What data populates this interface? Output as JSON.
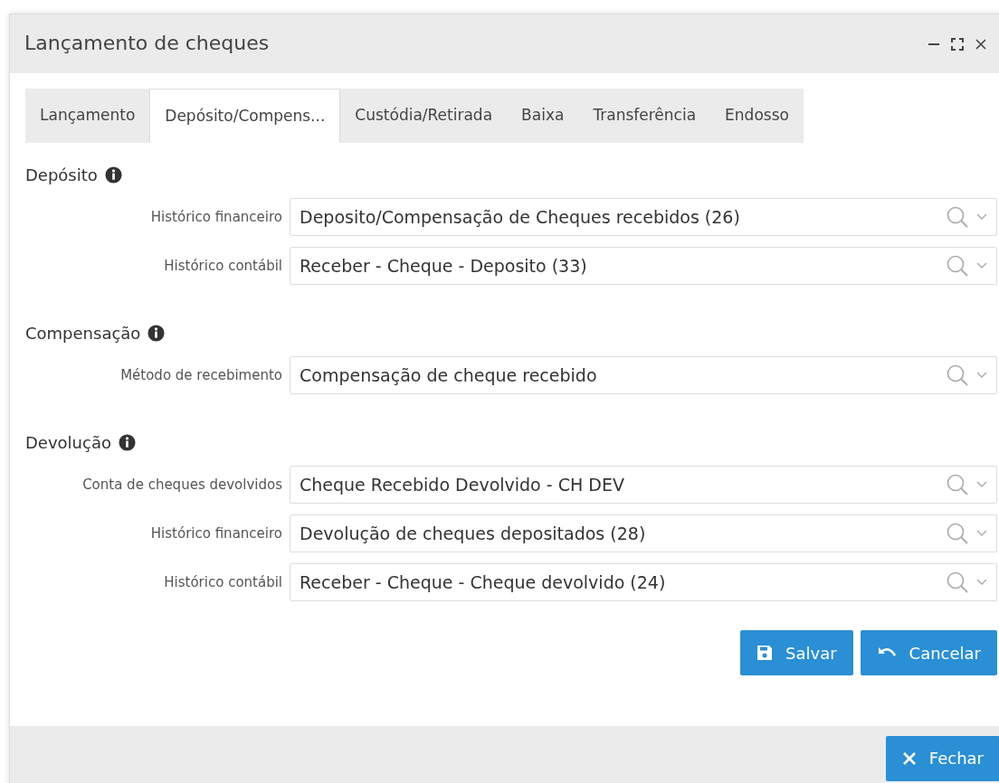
{
  "window": {
    "title": "Lançamento de cheques"
  },
  "tabs": [
    {
      "label": "Lançamento",
      "selected": false
    },
    {
      "label": "Depósito/Compens...",
      "selected": true
    },
    {
      "label": "Custódia/Retirada",
      "selected": false
    },
    {
      "label": "Baixa",
      "selected": false
    },
    {
      "label": "Transferência",
      "selected": false
    },
    {
      "label": "Endosso",
      "selected": false
    }
  ],
  "sections": [
    {
      "title": "Depósito",
      "fields": [
        {
          "label": "Histórico financeiro",
          "value": "Deposito/Compensação de Cheques recebidos (26)"
        },
        {
          "label": "Histórico contábil",
          "value": "Receber - Cheque - Deposito (33)"
        }
      ]
    },
    {
      "title": "Compensação",
      "fields": [
        {
          "label": "Método de recebimento",
          "value": "Compensação de cheque recebido"
        }
      ]
    },
    {
      "title": "Devolução",
      "fields": [
        {
          "label": "Conta de cheques devolvidos",
          "value": "Cheque Recebido Devolvido - CH DEV"
        },
        {
          "label": "Histórico financeiro",
          "value": "Devolução de cheques depositados (28)"
        },
        {
          "label": "Histórico contábil",
          "value": "Receber - Cheque - Cheque devolvido (24)"
        }
      ]
    }
  ],
  "buttons": [
    {
      "label": "Salvar",
      "kind": "save"
    },
    {
      "label": "Cancelar",
      "kind": "undo"
    }
  ],
  "footer": {
    "buttons": [
      {
        "label": "Fechar",
        "kind": "close"
      }
    ]
  }
}
